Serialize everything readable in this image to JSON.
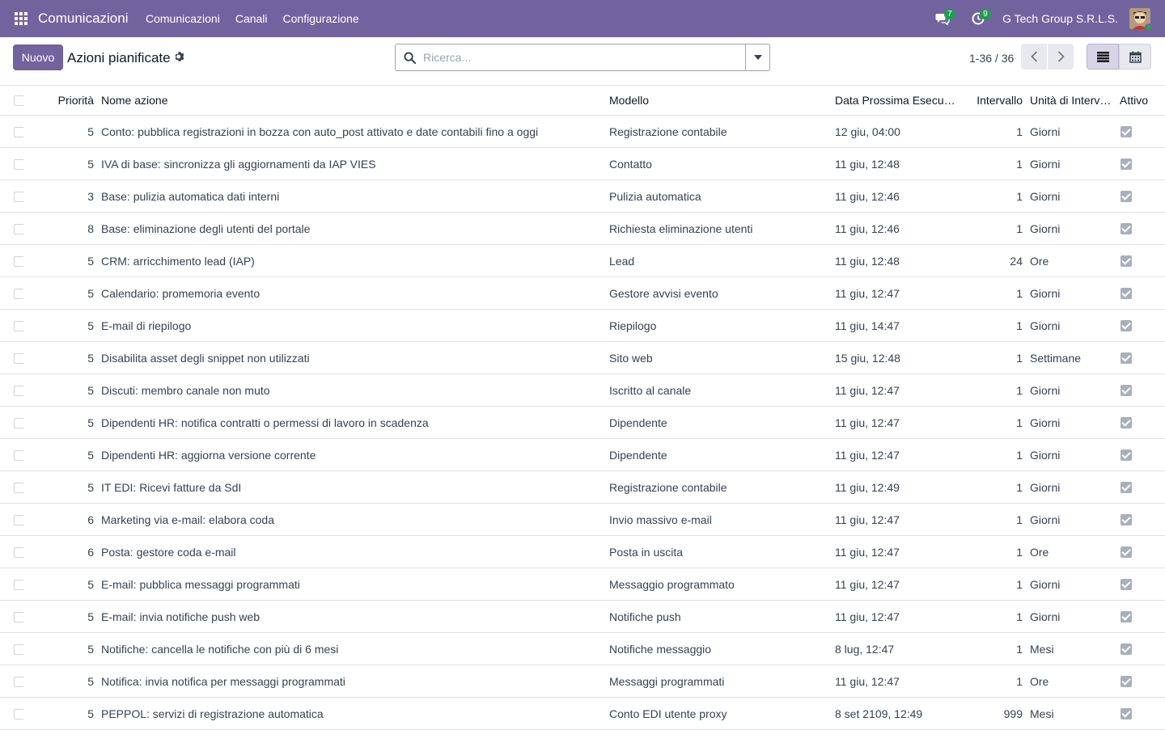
{
  "navbar": {
    "app_title": "Comunicazioni",
    "menu": [
      "Comunicazioni",
      "Canali",
      "Configurazione"
    ],
    "messages_count": "7",
    "activities_count": "9",
    "company": "G Tech Group S.R.L.S.",
    "accent_color": "#71639e"
  },
  "control": {
    "new_label": "Nuovo",
    "breadcrumb": "Azioni pianificate",
    "search_placeholder": "Ricerca...",
    "pager": "1-36 / 36"
  },
  "table": {
    "headers": {
      "priority": "Priorità",
      "name": "Nome azione",
      "model": "Modello",
      "next_date": "Data Prossima Esecuzione",
      "interval": "Intervallo",
      "unit": "Unità di Intervallo",
      "active": "Attivo"
    },
    "rows": [
      {
        "priority": "5",
        "name": "Conto: pubblica registrazioni in bozza con auto_post attivato e date contabili fino a oggi",
        "model": "Registrazione contabile",
        "date": "12 giu, 04:00",
        "interval": "1",
        "unit": "Giorni"
      },
      {
        "priority": "5",
        "name": "IVA di base: sincronizza gli aggiornamenti da IAP VIES",
        "model": "Contatto",
        "date": "11 giu, 12:48",
        "interval": "1",
        "unit": "Giorni"
      },
      {
        "priority": "3",
        "name": "Base: pulizia automatica dati interni",
        "model": "Pulizia automatica",
        "date": "11 giu, 12:46",
        "interval": "1",
        "unit": "Giorni"
      },
      {
        "priority": "8",
        "name": "Base: eliminazione degli utenti del portale",
        "model": "Richiesta eliminazione utenti",
        "date": "11 giu, 12:46",
        "interval": "1",
        "unit": "Giorni"
      },
      {
        "priority": "5",
        "name": "CRM: arricchimento lead (IAP)",
        "model": "Lead",
        "date": "11 giu, 12:48",
        "interval": "24",
        "unit": "Ore"
      },
      {
        "priority": "5",
        "name": "Calendario: promemoria evento",
        "model": "Gestore avvisi evento",
        "date": "11 giu, 12:47",
        "interval": "1",
        "unit": "Giorni"
      },
      {
        "priority": "5",
        "name": "E-mail di riepilogo",
        "model": "Riepilogo",
        "date": "11 giu, 14:47",
        "interval": "1",
        "unit": "Giorni"
      },
      {
        "priority": "5",
        "name": "Disabilita asset degli snippet non utilizzati",
        "model": "Sito web",
        "date": "15 giu, 12:48",
        "interval": "1",
        "unit": "Settimane"
      },
      {
        "priority": "5",
        "name": "Discuti: membro canale non muto",
        "model": "Iscritto al canale",
        "date": "11 giu, 12:47",
        "interval": "1",
        "unit": "Giorni"
      },
      {
        "priority": "5",
        "name": "Dipendenti HR: notifica contratti o permessi di lavoro in scadenza",
        "model": "Dipendente",
        "date": "11 giu, 12:47",
        "interval": "1",
        "unit": "Giorni"
      },
      {
        "priority": "5",
        "name": "Dipendenti HR: aggiorna versione corrente",
        "model": "Dipendente",
        "date": "11 giu, 12:47",
        "interval": "1",
        "unit": "Giorni"
      },
      {
        "priority": "5",
        "name": "IT EDI: Ricevi fatture da SdI",
        "model": "Registrazione contabile",
        "date": "11 giu, 12:49",
        "interval": "1",
        "unit": "Giorni"
      },
      {
        "priority": "6",
        "name": "Marketing via e-mail: elabora coda",
        "model": "Invio massivo e-mail",
        "date": "11 giu, 12:47",
        "interval": "1",
        "unit": "Giorni"
      },
      {
        "priority": "6",
        "name": "Posta: gestore coda e-mail",
        "model": "Posta in uscita",
        "date": "11 giu, 12:47",
        "interval": "1",
        "unit": "Ore"
      },
      {
        "priority": "5",
        "name": "E-mail: pubblica messaggi programmati",
        "model": "Messaggio programmato",
        "date": "11 giu, 12:47",
        "interval": "1",
        "unit": "Giorni"
      },
      {
        "priority": "5",
        "name": "E-mail: invia notifiche push web",
        "model": "Notifiche push",
        "date": "11 giu, 12:47",
        "interval": "1",
        "unit": "Giorni"
      },
      {
        "priority": "5",
        "name": "Notifiche: cancella le notifiche con più di 6 mesi",
        "model": "Notifiche messaggio",
        "date": "8 lug, 12:47",
        "interval": "1",
        "unit": "Mesi"
      },
      {
        "priority": "5",
        "name": "Notifica: invia notifica per messaggi programmati",
        "model": "Messaggi programmati",
        "date": "11 giu, 12:47",
        "interval": "1",
        "unit": "Ore"
      },
      {
        "priority": "5",
        "name": "PEPPOL: servizi di registrazione automatica",
        "model": "Conto EDI utente proxy",
        "date": "8 set 2109, 12:49",
        "interval": "999",
        "unit": "Mesi"
      }
    ]
  }
}
